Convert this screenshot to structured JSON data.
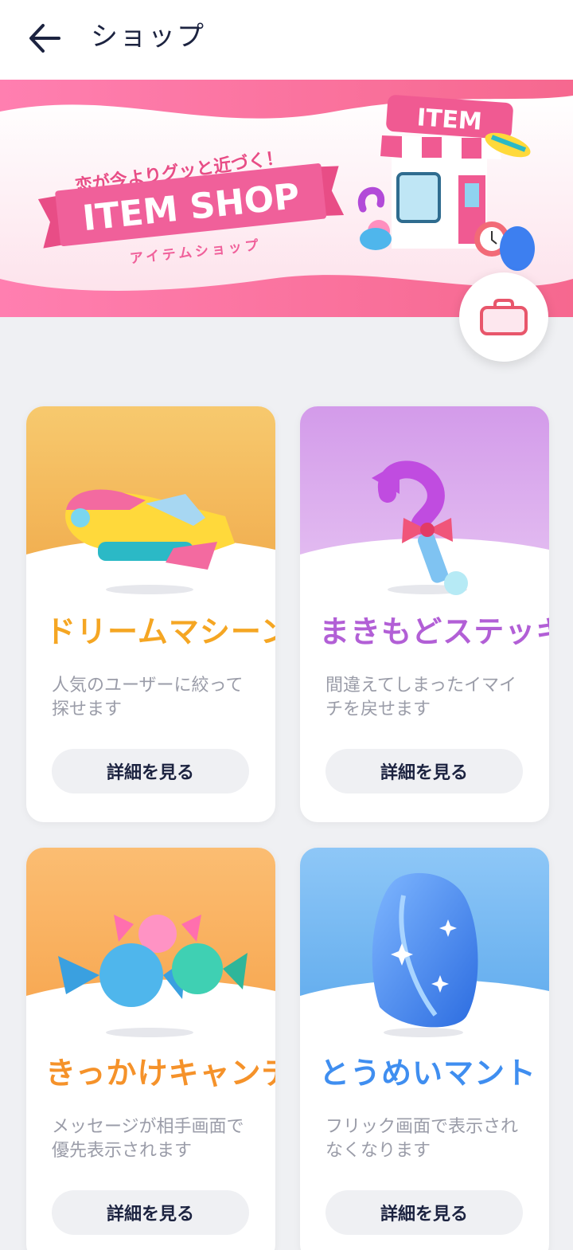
{
  "header": {
    "title": "ショップ"
  },
  "banner": {
    "tagline": "恋が今よりグッと近づく！",
    "title": "ITEM SHOP",
    "subtitle": "アイテムショップ",
    "store_sign": "ITEM"
  },
  "colors": {
    "accent": "#f0609a",
    "navy": "#1c2340",
    "button_bg": "#eff0f3"
  },
  "items": [
    {
      "name": "ドリームマシーン",
      "description": "人気のユーザーに絞って探せます",
      "button": "詳細を見る",
      "name_color": "#f5a623"
    },
    {
      "name": "まきもどステッキ",
      "description": "間違えてしまったイマイチを戻せます",
      "button": "詳細を見る",
      "name_color": "#b25fd6"
    },
    {
      "name": "きっかけキャンディ",
      "description": "メッセージが相手画面で優先表示されます",
      "button": "詳細を見る",
      "name_color": "#f5922a"
    },
    {
      "name": "とうめいマント",
      "description": "フリック画面で表示されなくなります",
      "button": "詳細を見る",
      "name_color": "#3f8ef0"
    }
  ]
}
